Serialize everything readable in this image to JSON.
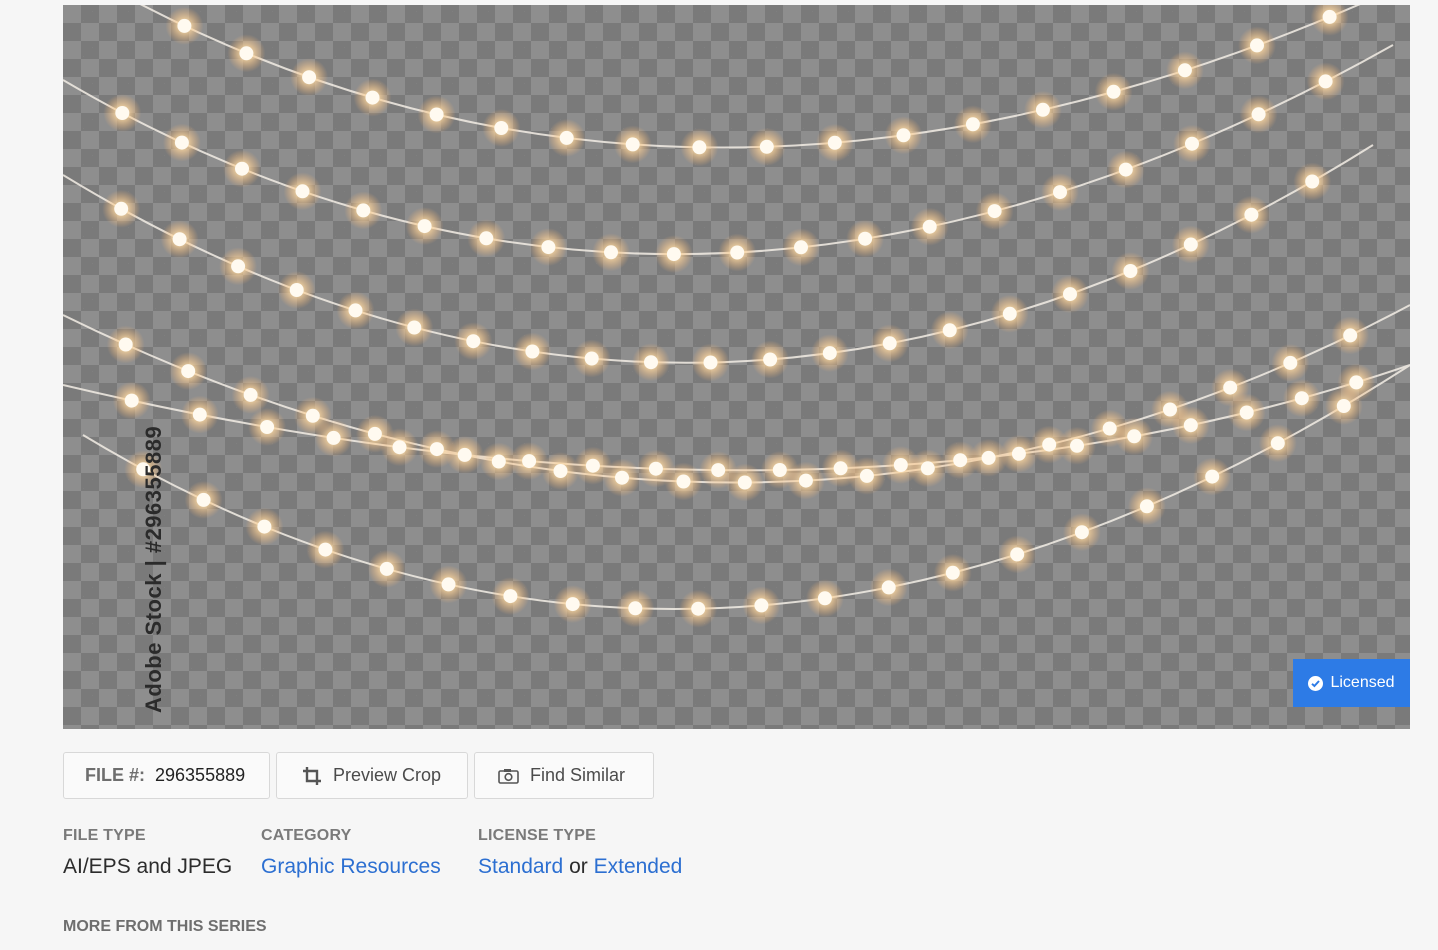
{
  "preview": {
    "side_watermark": "Adobe Stock | #296355889",
    "licensed_label": "Licensed",
    "accent_color": "#2d7be6"
  },
  "actions": {
    "file_label": "FILE #:",
    "file_number": "296355889",
    "preview_crop": "Preview Crop",
    "find_similar": "Find Similar",
    "crop_icon": "crop-icon",
    "camera_icon": "camera-icon"
  },
  "details": {
    "file_type_label": "FILE TYPE",
    "file_type_value": "AI/EPS and JPEG",
    "category_label": "CATEGORY",
    "category_value": "Graphic Resources",
    "license_label": "LICENSE TYPE",
    "license_standard": "Standard",
    "license_or": "or",
    "license_extended": "Extended",
    "link_color": "#2c6fd1"
  },
  "series": {
    "label": "MORE FROM THIS SERIES"
  }
}
